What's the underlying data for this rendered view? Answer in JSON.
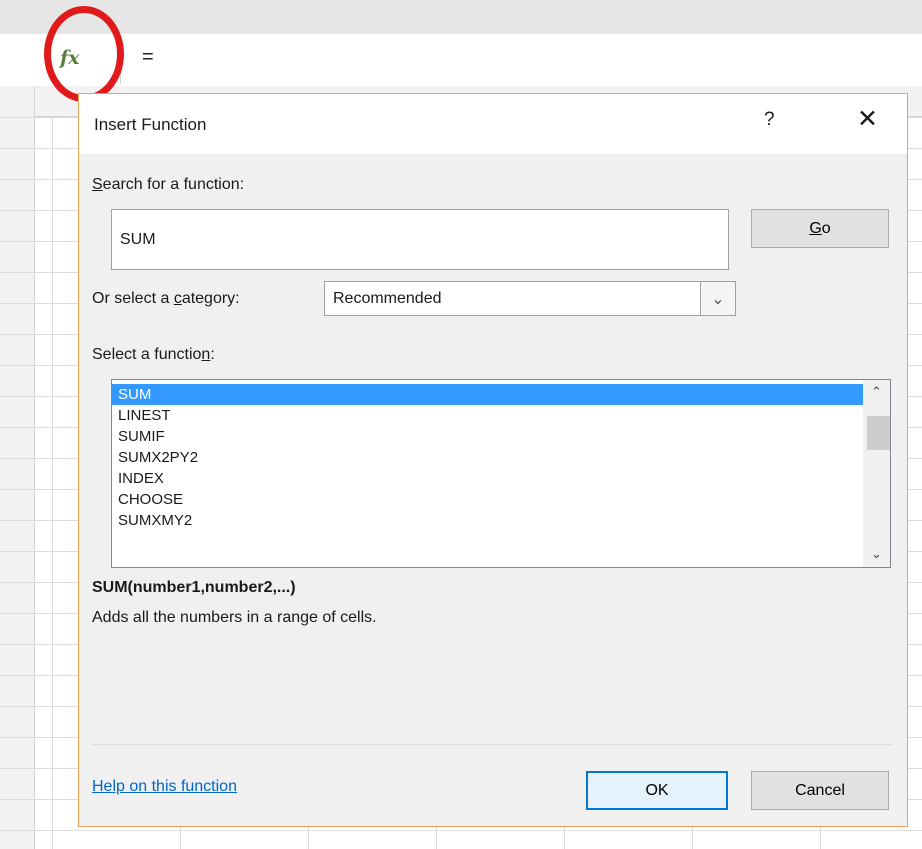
{
  "formula_bar": {
    "fx_icon": "fx",
    "content": "="
  },
  "dialog": {
    "title": "Insert Function",
    "help_icon": "?",
    "close_icon": "✕",
    "search": {
      "label_prefix": "",
      "label_accel": "S",
      "label_rest": "earch for a function:",
      "value": "SUM",
      "go_accel": "G",
      "go_rest": "o"
    },
    "category": {
      "label_prefix": "Or select a ",
      "label_accel": "c",
      "label_rest": "ategory:",
      "selected": "Recommended",
      "arrow": "⌄"
    },
    "function_list": {
      "label_prefix": "Select a functio",
      "label_accel": "n",
      "label_rest": ":",
      "items": [
        "SUM",
        "LINEST",
        "SUMIF",
        "SUMX2PY2",
        "INDEX",
        "CHOOSE",
        "SUMXMY2"
      ],
      "selected_index": 0,
      "scroll_up": "⌃",
      "scroll_down": "⌄"
    },
    "signature": "SUM(number1,number2,...)",
    "description": "Adds all the numbers in a range of cells.",
    "help_link": "Help on this function",
    "ok_label": "OK",
    "cancel_label": "Cancel"
  },
  "colors": {
    "accent_border": "#e7a25a",
    "selection": "#3399ff",
    "link": "#0066cc",
    "highlight_circle": "#e01a1a"
  }
}
